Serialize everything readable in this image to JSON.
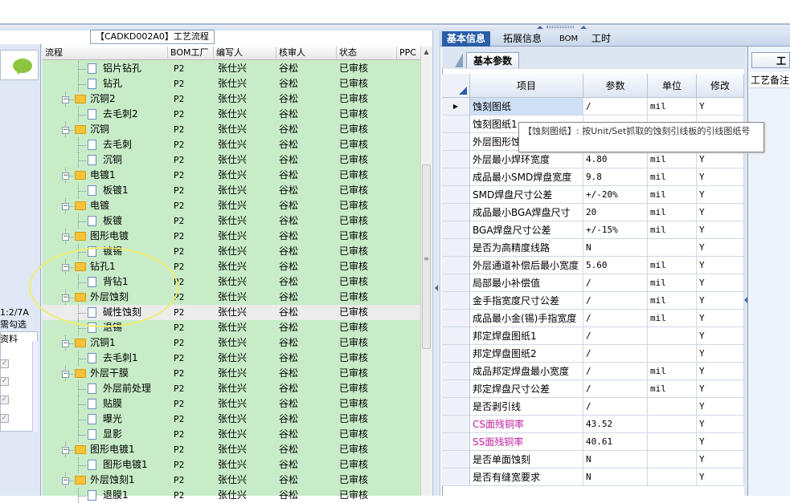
{
  "window_title": "【CADKD002A0】工艺流程",
  "left_panel": {
    "note1": "1:2/7A",
    "note2": "需勾选",
    "grid_header": "资料",
    "chat_icon": "chat-bubble-icon"
  },
  "tree": {
    "headers": [
      "流程",
      "BOM工厂",
      "编写人",
      "核审人",
      "状态",
      "PPC"
    ],
    "rows": [
      {
        "name": "铝片钻孔",
        "level": 1,
        "type": "file",
        "bom": "P2",
        "writer": "张仕兴",
        "reviewer": "谷松",
        "status": "已审核"
      },
      {
        "name": "钻孔",
        "level": 1,
        "type": "file",
        "bom": "P2",
        "writer": "张仕兴",
        "reviewer": "谷松",
        "status": "已审核"
      },
      {
        "name": "沉铜2",
        "level": 0,
        "type": "folder",
        "bom": "P2",
        "writer": "张仕兴",
        "reviewer": "谷松",
        "status": "已审核"
      },
      {
        "name": "去毛刺2",
        "level": 1,
        "type": "file",
        "bom": "P2",
        "writer": "张仕兴",
        "reviewer": "谷松",
        "status": "已审核"
      },
      {
        "name": "沉铜",
        "level": 0,
        "type": "folder",
        "bom": "P2",
        "writer": "张仕兴",
        "reviewer": "谷松",
        "status": "已审核"
      },
      {
        "name": "去毛刺",
        "level": 1,
        "type": "file",
        "bom": "P2",
        "writer": "张仕兴",
        "reviewer": "谷松",
        "status": "已审核"
      },
      {
        "name": "沉铜",
        "level": 1,
        "type": "file",
        "bom": "P2",
        "writer": "张仕兴",
        "reviewer": "谷松",
        "status": "已审核"
      },
      {
        "name": "电镀1",
        "level": 0,
        "type": "folder",
        "bom": "P2",
        "writer": "张仕兴",
        "reviewer": "谷松",
        "status": "已审核"
      },
      {
        "name": "板镀1",
        "level": 1,
        "type": "file",
        "bom": "P2",
        "writer": "张仕兴",
        "reviewer": "谷松",
        "status": "已审核"
      },
      {
        "name": "电镀",
        "level": 0,
        "type": "folder",
        "bom": "P2",
        "writer": "张仕兴",
        "reviewer": "谷松",
        "status": "已审核"
      },
      {
        "name": "板镀",
        "level": 1,
        "type": "file",
        "bom": "P2",
        "writer": "张仕兴",
        "reviewer": "谷松",
        "status": "已审核"
      },
      {
        "name": "图形电镀",
        "level": 0,
        "type": "folder",
        "bom": "P2",
        "writer": "张仕兴",
        "reviewer": "谷松",
        "status": "已审核"
      },
      {
        "name": "镀锡",
        "level": 1,
        "type": "file",
        "bom": "P2",
        "writer": "张仕兴",
        "reviewer": "谷松",
        "status": "已审核"
      },
      {
        "name": "钻孔1",
        "level": 0,
        "type": "folder",
        "bom": "P2",
        "writer": "张仕兴",
        "reviewer": "谷松",
        "status": "已审核"
      },
      {
        "name": "背钻1",
        "level": 1,
        "type": "file",
        "bom": "P2",
        "writer": "张仕兴",
        "reviewer": "谷松",
        "status": "已审核"
      },
      {
        "name": "外层蚀刻",
        "level": 0,
        "type": "folder",
        "bom": "P2",
        "writer": "张仕兴",
        "reviewer": "谷松",
        "status": "已审核"
      },
      {
        "name": "碱性蚀刻",
        "level": 1,
        "type": "file",
        "bom": "P2",
        "writer": "张仕兴",
        "reviewer": "谷松",
        "status": "已审核",
        "selected": true
      },
      {
        "name": "退锡",
        "level": 1,
        "type": "file",
        "bom": "P2",
        "writer": "张仕兴",
        "reviewer": "谷松",
        "status": "已审核"
      },
      {
        "name": "沉铜1",
        "level": 0,
        "type": "folder",
        "bom": "P2",
        "writer": "张仕兴",
        "reviewer": "谷松",
        "status": "已审核"
      },
      {
        "name": "去毛刺1",
        "level": 1,
        "type": "file",
        "bom": "P2",
        "writer": "张仕兴",
        "reviewer": "谷松",
        "status": "已审核"
      },
      {
        "name": "外层干膜",
        "level": 0,
        "type": "folder",
        "bom": "P2",
        "writer": "张仕兴",
        "reviewer": "谷松",
        "status": "已审核"
      },
      {
        "name": "外层前处理",
        "level": 1,
        "type": "file",
        "bom": "P2",
        "writer": "张仕兴",
        "reviewer": "谷松",
        "status": "已审核"
      },
      {
        "name": "贴膜",
        "level": 1,
        "type": "file",
        "bom": "P2",
        "writer": "张仕兴",
        "reviewer": "谷松",
        "status": "已审核"
      },
      {
        "name": "曝光",
        "level": 1,
        "type": "file",
        "bom": "P2",
        "writer": "张仕兴",
        "reviewer": "谷松",
        "status": "已审核"
      },
      {
        "name": "显影",
        "level": 1,
        "type": "file",
        "bom": "P2",
        "writer": "张仕兴",
        "reviewer": "谷松",
        "status": "已审核"
      },
      {
        "name": "图形电镀1",
        "level": 0,
        "type": "folder",
        "bom": "P2",
        "writer": "张仕兴",
        "reviewer": "谷松",
        "status": "已审核"
      },
      {
        "name": "图形电镀1",
        "level": 1,
        "type": "file",
        "bom": "P2",
        "writer": "张仕兴",
        "reviewer": "谷松",
        "status": "已审核"
      },
      {
        "name": "外层蚀刻1",
        "level": 0,
        "type": "folder",
        "bom": "P2",
        "writer": "张仕兴",
        "reviewer": "谷松",
        "status": "已审核"
      },
      {
        "name": "退膜1",
        "level": 1,
        "type": "file",
        "bom": "P2",
        "writer": "张仕兴",
        "reviewer": "谷松",
        "status": "已审核"
      }
    ]
  },
  "right_tabs": [
    "基本信息",
    "拓展信息",
    "BOM",
    "工时"
  ],
  "sub_tab": "基本参数",
  "param_headers": [
    "项目",
    "参数",
    "单位",
    "修改"
  ],
  "params": [
    {
      "item": "蚀刻图纸",
      "value": "/",
      "unit": "mil",
      "edit": "Y",
      "current": true
    },
    {
      "item": "蚀刻图纸1",
      "value": "",
      "unit": "",
      "edit": ""
    },
    {
      "item": "外层图形蚀",
      "value": "",
      "unit": "",
      "edit": ""
    },
    {
      "item": "外层最小焊环宽度",
      "value": "4.80",
      "unit": "mil",
      "edit": "Y"
    },
    {
      "item": "成品最小SMD焊盘宽度",
      "value": "9.8",
      "unit": "mil",
      "edit": "Y"
    },
    {
      "item": "SMD焊盘尺寸公差",
      "value": "+/-20%",
      "unit": "mil",
      "edit": "Y"
    },
    {
      "item": "成品最小BGA焊盘尺寸",
      "value": "20",
      "unit": "mil",
      "edit": "Y"
    },
    {
      "item": "BGA焊盘尺寸公差",
      "value": "+/-15%",
      "unit": "mil",
      "edit": "Y"
    },
    {
      "item": "是否为高精度线路",
      "value": "N",
      "unit": "",
      "edit": "Y"
    },
    {
      "item": "外层通道补偿后最小宽度",
      "value": "5.60",
      "unit": "mil",
      "edit": "Y"
    },
    {
      "item": "局部最小补偿值",
      "value": "/",
      "unit": "mil",
      "edit": "Y"
    },
    {
      "item": "金手指宽度尺寸公差",
      "value": "/",
      "unit": "mil",
      "edit": "Y"
    },
    {
      "item": "成品最小金(锡)手指宽度",
      "value": "/",
      "unit": "mil",
      "edit": "Y"
    },
    {
      "item": "邦定焊盘图纸1",
      "value": "/",
      "unit": "",
      "edit": "Y"
    },
    {
      "item": "邦定焊盘图纸2",
      "value": "/",
      "unit": "",
      "edit": "Y"
    },
    {
      "item": "成品邦定焊盘最小宽度",
      "value": "/",
      "unit": "mil",
      "edit": "Y"
    },
    {
      "item": "邦定焊盘尺寸公差",
      "value": "/",
      "unit": "mil",
      "edit": "Y"
    },
    {
      "item": "是否剥引线",
      "value": "/",
      "unit": "",
      "edit": "Y"
    },
    {
      "item": "CS面残铜率",
      "value": "43.52",
      "unit": "",
      "edit": "Y",
      "magenta": true
    },
    {
      "item": "SS面残铜率",
      "value": "40.61",
      "unit": "",
      "edit": "Y",
      "magenta": true
    },
    {
      "item": "是否单面蚀刻",
      "value": "N",
      "unit": "",
      "edit": "Y"
    },
    {
      "item": "是否有缝宽要求",
      "value": "N",
      "unit": "",
      "edit": "Y"
    }
  ],
  "tooltip": "【蚀刻图纸】: 按Unit/Set抓取的蚀刻引线板的引线图纸号",
  "far_right": {
    "tab": "工",
    "header": "工艺备注"
  },
  "colors": {
    "tree_bg": "#c8ecc8",
    "accent": "#2a5ea8",
    "magenta": "#c020a0",
    "highlight_circle": "#f0ec70"
  }
}
